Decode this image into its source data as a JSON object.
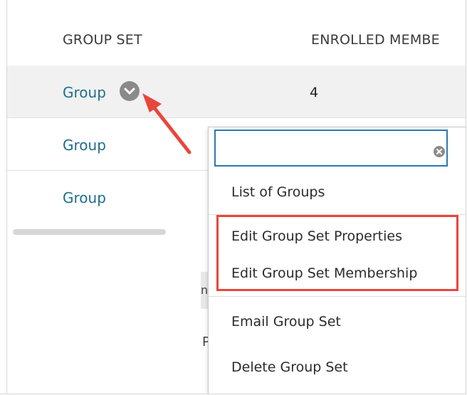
{
  "table": {
    "headers": {
      "group_set": "GROUP SET",
      "enrolled_members": "ENROLLED MEMBE"
    },
    "rows": [
      {
        "name": "Group",
        "enrolled": "4"
      },
      {
        "name": "Group",
        "enrolled": ""
      },
      {
        "name": "Group",
        "enrolled": ""
      }
    ]
  },
  "dropdown": {
    "search_value": "",
    "items": [
      {
        "label": "List of Groups"
      },
      {
        "label": "Edit Group Set Properties"
      },
      {
        "label": "Edit Group Set Membership"
      },
      {
        "label": "Email Group Set"
      },
      {
        "label": "Delete Group Set"
      }
    ]
  },
  "background_fragments": {
    "fragment_1": "n",
    "fragment_2": "P"
  },
  "annotations": {
    "highlight_color": "#e8463b",
    "arrow_color": "#e8463b"
  },
  "colors": {
    "link": "#1d6e8f",
    "search_border": "#2a7ab0",
    "selected_row_bg": "#f1f1f1"
  },
  "icons": {
    "row_menu": "chevron-down-icon",
    "clear_search": "clear-icon"
  }
}
